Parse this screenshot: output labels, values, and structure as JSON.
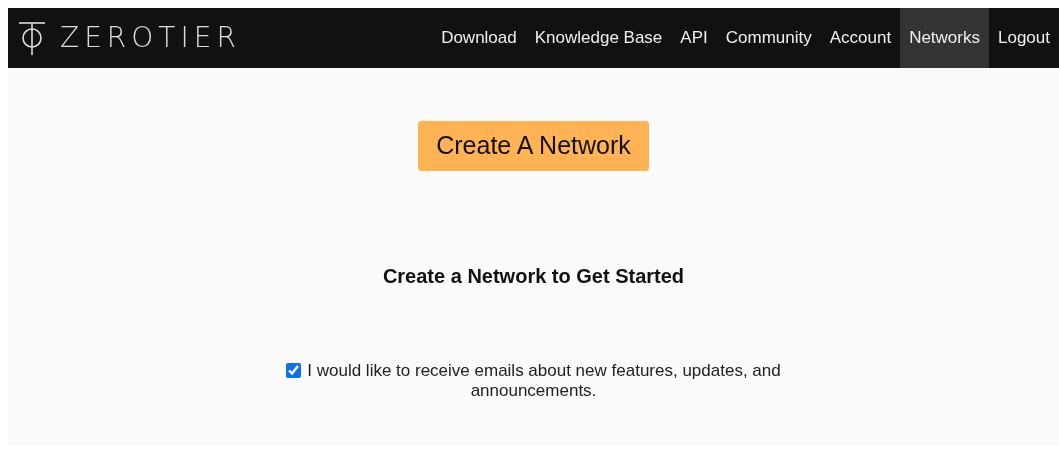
{
  "brand": {
    "name": "ZEROTIER"
  },
  "nav": [
    {
      "label": "Download",
      "selected": false
    },
    {
      "label": "Knowledge Base",
      "selected": false
    },
    {
      "label": "API",
      "selected": false
    },
    {
      "label": "Community",
      "selected": false
    },
    {
      "label": "Account",
      "selected": false
    },
    {
      "label": "Networks",
      "selected": true
    },
    {
      "label": "Logout",
      "selected": false
    }
  ],
  "create_button": {
    "label": "Create A Network"
  },
  "heading": "Create a Network to Get Started",
  "newsletter": {
    "label": "I would like to receive emails about new features, updates, and announcements.",
    "checked": true
  }
}
